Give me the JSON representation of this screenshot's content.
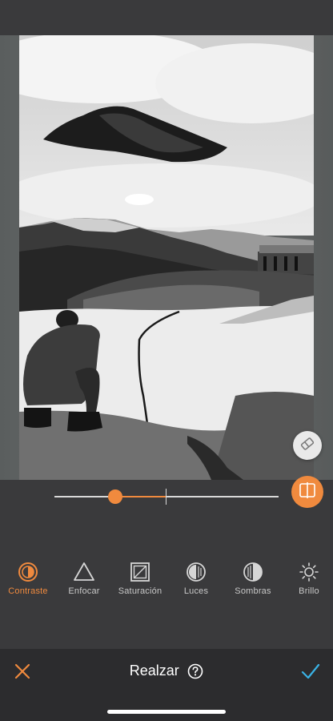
{
  "editor": {
    "slider": {
      "value": 0.27,
      "min": 0,
      "max": 1,
      "neutral": 0.5
    },
    "actions": {
      "eraser_icon": "eraser-icon",
      "compare_icon": "compare-icon"
    }
  },
  "tools": [
    {
      "label": "Contraste",
      "icon": "contrast-icon",
      "active": true
    },
    {
      "label": "Enfocar",
      "icon": "sharpen-triangle-icon",
      "active": false
    },
    {
      "label": "Saturación",
      "icon": "saturation-icon",
      "active": false
    },
    {
      "label": "Luces",
      "icon": "highlights-icon",
      "active": false
    },
    {
      "label": "Sombras",
      "icon": "shadows-icon",
      "active": false
    },
    {
      "label": "Brillo",
      "icon": "brightness-sun-icon",
      "active": false
    }
  ],
  "bottom_bar": {
    "title": "Realzar",
    "cancel_icon": "close-icon",
    "confirm_icon": "checkmark-icon",
    "help_icon": "help-icon"
  },
  "colors": {
    "accent": "#f08a3e",
    "confirm": "#3ab3e6",
    "background": "#3a3a3c",
    "bottom_bar": "#2c2c2e"
  }
}
